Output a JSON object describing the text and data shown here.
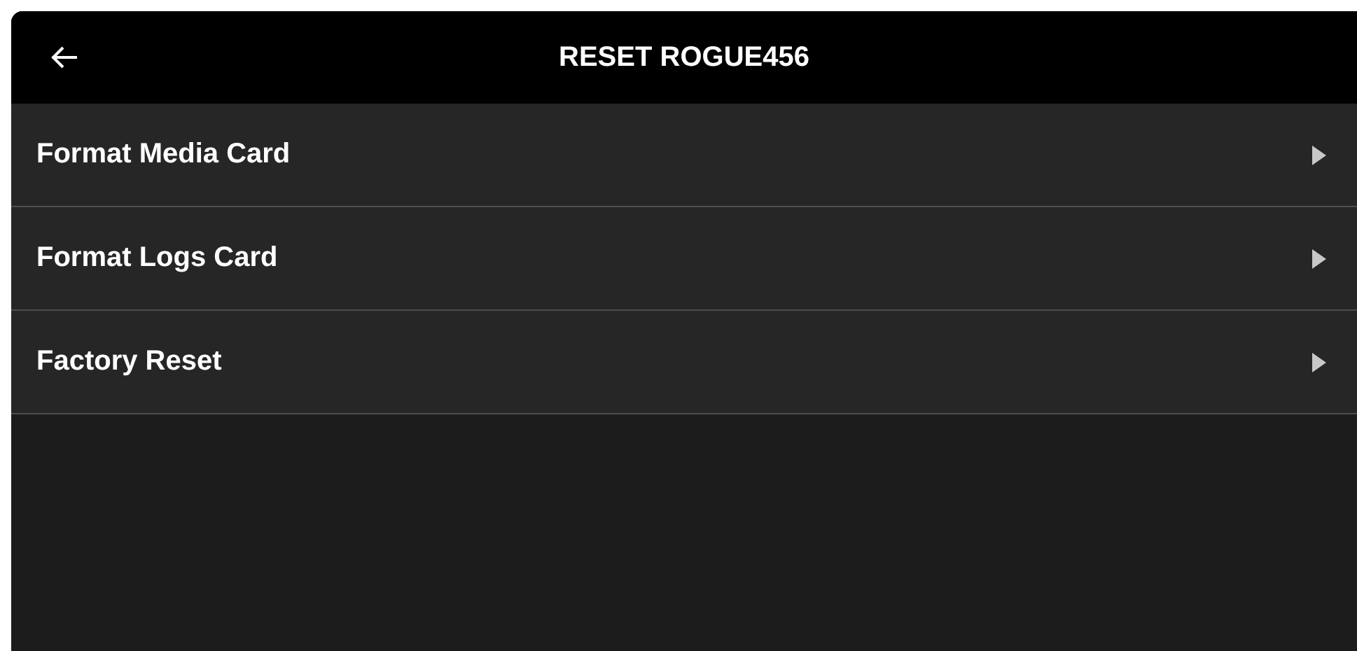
{
  "header": {
    "title": "RESET ROGUE456"
  },
  "menu_items": [
    {
      "label": "Format Media Card"
    },
    {
      "label": "Format Logs Card"
    },
    {
      "label": "Factory Reset"
    }
  ]
}
